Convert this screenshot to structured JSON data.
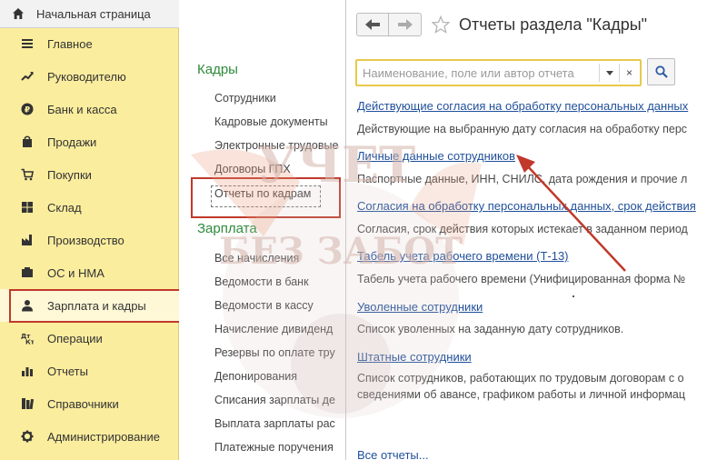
{
  "sidebar": {
    "home_label": "Начальная страница",
    "items": [
      {
        "label": "Главное",
        "icon": "menu-lines-icon"
      },
      {
        "label": "Руководителю",
        "icon": "trend-up-icon"
      },
      {
        "label": "Банк и касса",
        "icon": "ruble-coin-icon"
      },
      {
        "label": "Продажи",
        "icon": "shopping-bag-icon"
      },
      {
        "label": "Покупки",
        "icon": "cart-icon"
      },
      {
        "label": "Склад",
        "icon": "warehouse-icon"
      },
      {
        "label": "Производство",
        "icon": "factory-icon"
      },
      {
        "label": "ОС и НМА",
        "icon": "assets-icon"
      },
      {
        "label": "Зарплата и кадры",
        "icon": "person-icon"
      },
      {
        "label": "Операции",
        "icon": "operations-icon"
      },
      {
        "label": "Отчеты",
        "icon": "report-bars-icon"
      },
      {
        "label": "Справочники",
        "icon": "books-icon"
      },
      {
        "label": "Администрирование",
        "icon": "gear-icon"
      }
    ],
    "active_index": 8
  },
  "middle": {
    "section1_title": "Кадры",
    "section1_items": [
      "Сотрудники",
      "Кадровые документы",
      "Электронные трудовые",
      "Договоры ГПХ",
      "Отчеты по кадрам"
    ],
    "section2_title": "Зарплата",
    "section2_items": [
      "Все начисления",
      "Ведомости в банк",
      "Ведомости в кассу",
      "Начисление дивиденд",
      "Резервы по оплате тру",
      "Депонирования",
      "Списания зарплаты де",
      "Выплата зарплаты рас",
      "Платежные поручения"
    ]
  },
  "watermark": {
    "line1": "УЧЕТ",
    "line2": "БЕЗ ЗАБОТ"
  },
  "report_panel": {
    "title": "Отчеты раздела \"Кадры\"",
    "search_placeholder": "Наименование, поле или автор отчета",
    "clear_symbol": "×",
    "reports": [
      {
        "link": "Действующие согласия на обработку персональных данных",
        "desc": "Действующие на выбранную дату согласия на обработку перс"
      },
      {
        "link": "Личные данные сотрудников",
        "desc": "Паспортные данные, ИНН, СНИЛС, дата рождения и прочие л"
      },
      {
        "link": "Согласия на обработку персональных данных, срок действия",
        "desc": "Согласия, срок действия которых истекает в заданном период"
      },
      {
        "link": "Табель учета рабочего времени (Т-13)",
        "desc": "Табель учета рабочего времени (Унифицированная форма №"
      },
      {
        "link": "Уволенные сотрудники",
        "desc": "Список уволенных на заданную дату сотрудников."
      },
      {
        "link": "Штатные сотрудники",
        "desc": "Список сотрудников, работающих по трудовым договорам с о",
        "desc2": "сведениями об авансе, графиком работы и личной информац"
      }
    ],
    "all_reports_label": "Все отчеты..."
  },
  "colors": {
    "sidebar_bg": "#fbed9e",
    "section_green": "#2e8b3a",
    "link_blue": "#1f4f9a",
    "highlight_red": "#c0392b",
    "search_border": "#e8c94c"
  }
}
